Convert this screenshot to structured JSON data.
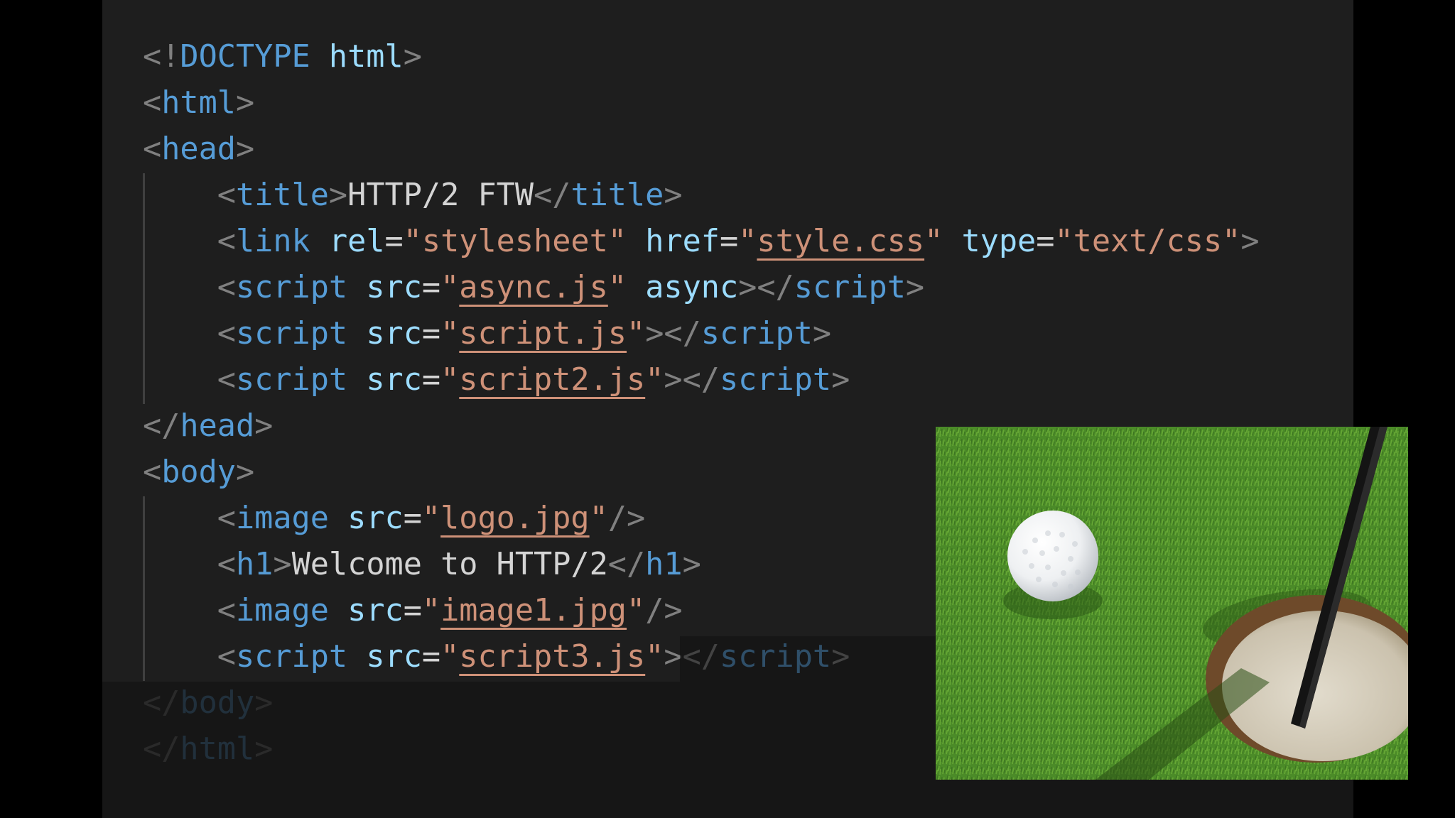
{
  "code": {
    "lines": [
      [
        {
          "c": "t-punct",
          "t": "<!"
        },
        {
          "c": "t-tag",
          "t": "DOCTYPE"
        },
        {
          "c": "t-text",
          "t": " "
        },
        {
          "c": "t-attr",
          "t": "html"
        },
        {
          "c": "t-punct",
          "t": ">"
        }
      ],
      [
        {
          "c": "t-punct",
          "t": "<"
        },
        {
          "c": "t-tag",
          "t": "html"
        },
        {
          "c": "t-punct",
          "t": ">"
        }
      ],
      [
        {
          "c": "t-punct",
          "t": "<"
        },
        {
          "c": "t-tag",
          "t": "head"
        },
        {
          "c": "t-punct",
          "t": ">"
        }
      ],
      [
        {
          "c": "t-text",
          "t": "    "
        },
        {
          "c": "t-punct",
          "t": "<"
        },
        {
          "c": "t-tag",
          "t": "title"
        },
        {
          "c": "t-punct",
          "t": ">"
        },
        {
          "c": "t-text",
          "t": "HTTP/2 FTW"
        },
        {
          "c": "t-punct",
          "t": "</"
        },
        {
          "c": "t-tag",
          "t": "title"
        },
        {
          "c": "t-punct",
          "t": ">"
        }
      ],
      [
        {
          "c": "t-text",
          "t": "    "
        },
        {
          "c": "t-punct",
          "t": "<"
        },
        {
          "c": "t-tag",
          "t": "link"
        },
        {
          "c": "t-text",
          "t": " "
        },
        {
          "c": "t-attr",
          "t": "rel"
        },
        {
          "c": "t-text",
          "t": "="
        },
        {
          "c": "t-str",
          "t": "\"stylesheet\""
        },
        {
          "c": "t-text",
          "t": " "
        },
        {
          "c": "t-attr",
          "t": "href"
        },
        {
          "c": "t-text",
          "t": "="
        },
        {
          "c": "t-str",
          "t": "\""
        },
        {
          "c": "t-link",
          "t": "style.css"
        },
        {
          "c": "t-str",
          "t": "\""
        },
        {
          "c": "t-text",
          "t": " "
        },
        {
          "c": "t-attr",
          "t": "type"
        },
        {
          "c": "t-text",
          "t": "="
        },
        {
          "c": "t-str",
          "t": "\"text/css\""
        },
        {
          "c": "t-punct",
          "t": ">"
        }
      ],
      [
        {
          "c": "t-text",
          "t": "    "
        },
        {
          "c": "t-punct",
          "t": "<"
        },
        {
          "c": "t-tag",
          "t": "script"
        },
        {
          "c": "t-text",
          "t": " "
        },
        {
          "c": "t-attr",
          "t": "src"
        },
        {
          "c": "t-text",
          "t": "="
        },
        {
          "c": "t-str",
          "t": "\""
        },
        {
          "c": "t-link",
          "t": "async.js"
        },
        {
          "c": "t-str",
          "t": "\""
        },
        {
          "c": "t-text",
          "t": " "
        },
        {
          "c": "t-attr",
          "t": "async"
        },
        {
          "c": "t-punct",
          "t": "></"
        },
        {
          "c": "t-tag",
          "t": "script"
        },
        {
          "c": "t-punct",
          "t": ">"
        }
      ],
      [
        {
          "c": "t-text",
          "t": "    "
        },
        {
          "c": "t-punct",
          "t": "<"
        },
        {
          "c": "t-tag",
          "t": "script"
        },
        {
          "c": "t-text",
          "t": " "
        },
        {
          "c": "t-attr",
          "t": "src"
        },
        {
          "c": "t-text",
          "t": "="
        },
        {
          "c": "t-str",
          "t": "\""
        },
        {
          "c": "t-link",
          "t": "script.js"
        },
        {
          "c": "t-str",
          "t": "\""
        },
        {
          "c": "t-punct",
          "t": "></"
        },
        {
          "c": "t-tag",
          "t": "script"
        },
        {
          "c": "t-punct",
          "t": ">"
        }
      ],
      [
        {
          "c": "t-text",
          "t": "    "
        },
        {
          "c": "t-punct",
          "t": "<"
        },
        {
          "c": "t-tag",
          "t": "script"
        },
        {
          "c": "t-text",
          "t": " "
        },
        {
          "c": "t-attr",
          "t": "src"
        },
        {
          "c": "t-text",
          "t": "="
        },
        {
          "c": "t-str",
          "t": "\""
        },
        {
          "c": "t-link",
          "t": "script2.js"
        },
        {
          "c": "t-str",
          "t": "\""
        },
        {
          "c": "t-punct",
          "t": "></"
        },
        {
          "c": "t-tag",
          "t": "script"
        },
        {
          "c": "t-punct",
          "t": ">"
        }
      ],
      [
        {
          "c": "t-punct",
          "t": "</"
        },
        {
          "c": "t-tag",
          "t": "head"
        },
        {
          "c": "t-punct",
          "t": ">"
        }
      ],
      [
        {
          "c": "t-punct",
          "t": "<"
        },
        {
          "c": "t-tag",
          "t": "body"
        },
        {
          "c": "t-punct",
          "t": ">"
        }
      ],
      [
        {
          "c": "t-text",
          "t": "    "
        },
        {
          "c": "t-punct",
          "t": "<"
        },
        {
          "c": "t-tag",
          "t": "image"
        },
        {
          "c": "t-text",
          "t": " "
        },
        {
          "c": "t-attr",
          "t": "src"
        },
        {
          "c": "t-text",
          "t": "="
        },
        {
          "c": "t-str",
          "t": "\""
        },
        {
          "c": "t-link",
          "t": "logo.jpg"
        },
        {
          "c": "t-str",
          "t": "\""
        },
        {
          "c": "t-punct",
          "t": "/>"
        }
      ],
      [
        {
          "c": "t-text",
          "t": "    "
        },
        {
          "c": "t-punct",
          "t": "<"
        },
        {
          "c": "t-tag",
          "t": "h1"
        },
        {
          "c": "t-punct",
          "t": ">"
        },
        {
          "c": "t-text",
          "t": "Welcome to HTTP/2"
        },
        {
          "c": "t-punct",
          "t": "</"
        },
        {
          "c": "t-tag",
          "t": "h1"
        },
        {
          "c": "t-punct",
          "t": ">"
        }
      ],
      [
        {
          "c": "t-text",
          "t": "    "
        },
        {
          "c": "t-punct",
          "t": "<"
        },
        {
          "c": "t-tag",
          "t": "image"
        },
        {
          "c": "t-text",
          "t": " "
        },
        {
          "c": "t-attr",
          "t": "src"
        },
        {
          "c": "t-text",
          "t": "="
        },
        {
          "c": "t-str",
          "t": "\""
        },
        {
          "c": "t-link",
          "t": "image1.jpg"
        },
        {
          "c": "t-str",
          "t": "\""
        },
        {
          "c": "t-punct",
          "t": "/>"
        }
      ],
      [
        {
          "c": "t-text",
          "t": "    "
        },
        {
          "c": "t-punct",
          "t": "<"
        },
        {
          "c": "t-tag",
          "t": "script"
        },
        {
          "c": "t-text",
          "t": " "
        },
        {
          "c": "t-attr",
          "t": "src"
        },
        {
          "c": "t-text",
          "t": "="
        },
        {
          "c": "t-str",
          "t": "\""
        },
        {
          "c": "t-link",
          "t": "script3.js"
        },
        {
          "c": "t-str",
          "t": "\""
        },
        {
          "c": "t-punct",
          "t": "></"
        },
        {
          "c": "t-tag",
          "t": "script"
        },
        {
          "c": "t-punct",
          "t": ">"
        }
      ],
      [
        {
          "c": "t-punct",
          "t": "</"
        },
        {
          "c": "t-tag",
          "t": "body"
        },
        {
          "c": "t-punct",
          "t": ">"
        }
      ],
      [
        {
          "c": "t-punct",
          "t": "</"
        },
        {
          "c": "t-tag",
          "t": "html"
        },
        {
          "c": "t-punct",
          "t": ">"
        }
      ]
    ]
  },
  "theme": {
    "background": "#1e1e1e",
    "tag": "#569cd6",
    "attribute": "#9cdcfe",
    "string": "#ce9178",
    "text": "#d4d4d4",
    "punctuation": "#808080"
  },
  "photo": {
    "subject": "golf-ball-near-hole-photo"
  }
}
